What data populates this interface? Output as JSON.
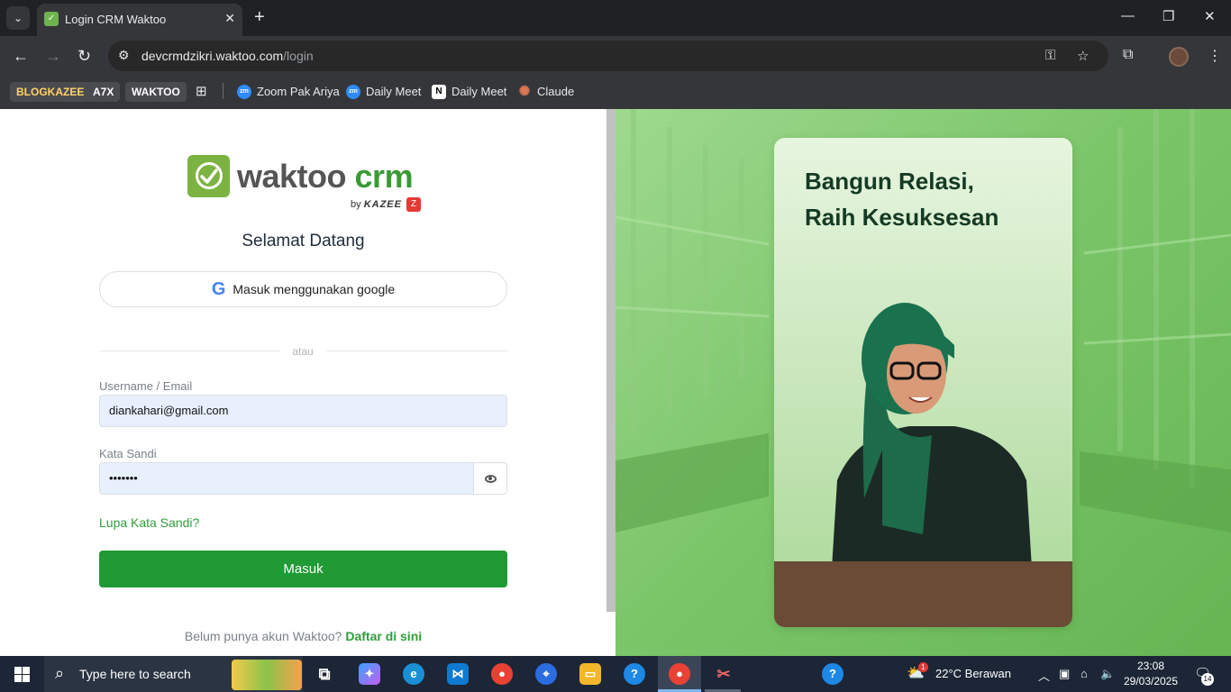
{
  "browser": {
    "tab_title": "Login CRM Waktoo",
    "url_domain": "devcrmdzikri.waktoo.com",
    "url_path": "/login",
    "bookmarks": [
      {
        "label": "BLOGKAZEE",
        "kind": "chip"
      },
      {
        "label": "A7X",
        "kind": "chip"
      },
      {
        "label": "WAKTOO",
        "kind": "chip"
      },
      {
        "label": "Zoom Pak Ariya",
        "icon": "zm"
      },
      {
        "label": "Daily Meet",
        "icon": "zm"
      },
      {
        "label": "Daily Meet",
        "icon": "N"
      },
      {
        "label": "Claude",
        "icon": "✺"
      }
    ]
  },
  "login": {
    "logo_wordmark": "waktoo",
    "logo_crm": "crm",
    "logo_by": "by",
    "logo_brand": "KAZEE",
    "welcome": "Selamat Datang",
    "google_button": "Masuk menggunakan google",
    "divider": "atau",
    "username_label": "Username / Email",
    "username_value": "diankahari@gmail.com",
    "password_label": "Kata Sandi",
    "password_value": "•••••••",
    "forgot": "Lupa Kata Sandi?",
    "submit": "Masuk",
    "register_prompt": "Belum punya akun Waktoo?",
    "register_link": "Daftar di sini"
  },
  "hero": {
    "headline_line1": "Bangun Relasi,",
    "headline_line2": "Raih Kesuksesan"
  },
  "taskbar": {
    "search_placeholder": "Type here to search",
    "weather": "22°C  Berawan",
    "weather_badge": "1",
    "time": "23:08",
    "date": "29/03/2025",
    "notifications": "14"
  },
  "colors": {
    "brand_green": "#1f9a34",
    "link_green": "#2e9e3a",
    "input_bg": "#e8f0fe"
  }
}
